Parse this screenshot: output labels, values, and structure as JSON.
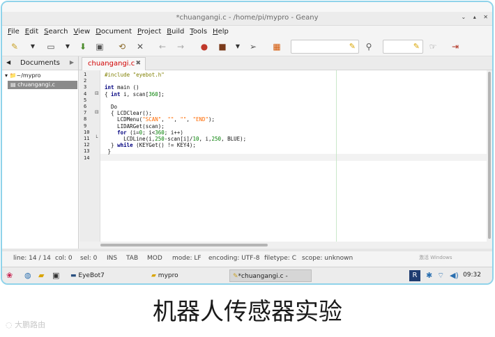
{
  "window": {
    "title": "*chuangangi.c - /home/pi/mypro - Geany",
    "controls": [
      "⌄",
      "▴",
      "✕"
    ]
  },
  "menu": [
    "File",
    "Edit",
    "Search",
    "View",
    "Document",
    "Project",
    "Build",
    "Tools",
    "Help"
  ],
  "sidebar": {
    "tab_label": "Documents",
    "root": "~/mypro",
    "file": "chuangangi.c"
  },
  "editor": {
    "tab_label": "chuangangi.c",
    "close": "✖",
    "line_numbers": [
      "1",
      "2",
      "3",
      "4",
      "5",
      "6",
      "7",
      "8",
      "9",
      "10",
      "11",
      "12",
      "13",
      "14"
    ]
  },
  "status": {
    "line": "line: 14 / 14",
    "col": "col: 0",
    "sel": "sel: 0",
    "ins": "INS",
    "tab": "TAB",
    "mod": "MOD",
    "mode": "mode: LF",
    "encoding": "encoding: UTF-8",
    "filetype": "filetype: C",
    "scope": "scope: unknown"
  },
  "watermark": "激活 Windows",
  "taskbar": {
    "task1": "EyeBot7",
    "task2": "mypro",
    "task3": "*chuangangi.c - /hom...",
    "time": "09:32"
  },
  "caption": "机器人传感器实验",
  "brand": "大鹏路由"
}
